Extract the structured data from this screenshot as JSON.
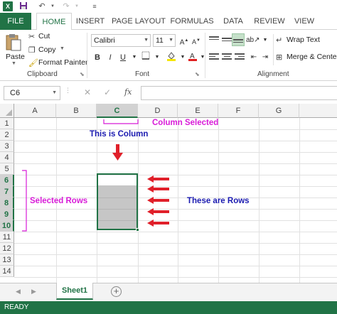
{
  "quick_access": {
    "undo_icon": "undo-icon",
    "redo_icon": "redo-icon",
    "save_icon": "save-icon"
  },
  "tabs": [
    {
      "label": "FILE"
    },
    {
      "label": "HOME"
    },
    {
      "label": "INSERT"
    },
    {
      "label": "PAGE LAYOUT"
    },
    {
      "label": "FORMULAS"
    },
    {
      "label": "DATA"
    },
    {
      "label": "REVIEW"
    },
    {
      "label": "VIEW"
    }
  ],
  "clipboard": {
    "cut": "Cut",
    "copy": "Copy",
    "paste": "Paste",
    "format_painter": "Format Painter",
    "group_label": "Clipboard"
  },
  "font": {
    "name": "Calibri",
    "size": "11",
    "bold": "B",
    "italic": "I",
    "underline": "U",
    "group_label": "Font"
  },
  "alignment": {
    "wrap_text": "Wrap Text",
    "merge_center": "Merge & Center",
    "group_label": "Alignment"
  },
  "formula_bar": {
    "name_box": "C6",
    "fx": "fx",
    "value": ""
  },
  "columns": [
    "A",
    "B",
    "C",
    "D",
    "E",
    "F",
    "G"
  ],
  "rows": [
    "1",
    "2",
    "3",
    "4",
    "5",
    "6",
    "7",
    "8",
    "9",
    "10",
    "11",
    "12",
    "13",
    "14"
  ],
  "annotations": {
    "column_selected": "Column Selected",
    "this_is_column": "This is Column",
    "selected_rows": "Selected Rows",
    "these_are_rows": "These are Rows"
  },
  "colors": {
    "excel_green": "#217346",
    "annotation_magenta": "#d81bd8",
    "annotation_blue": "#1a1ab0",
    "arrow_red": "#e0202a"
  },
  "sheets": [
    {
      "label": "Sheet1"
    }
  ],
  "status": "READY"
}
